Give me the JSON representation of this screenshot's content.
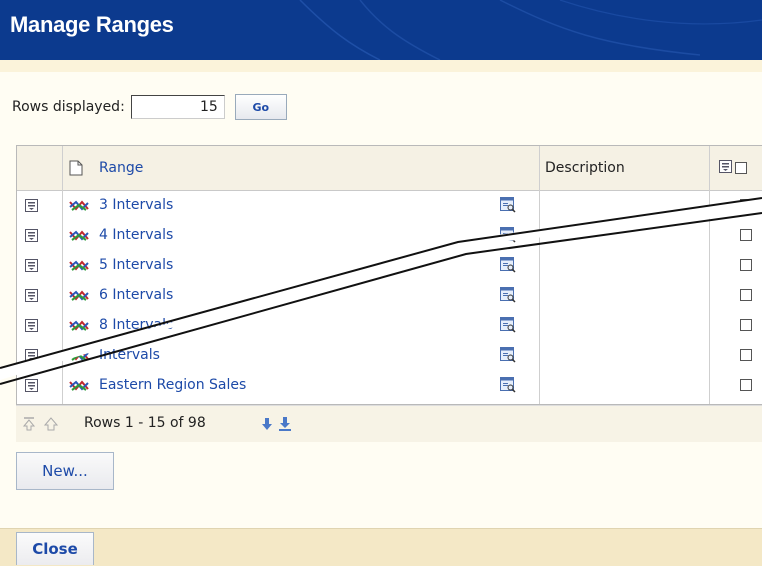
{
  "header": {
    "title": "Manage Ranges"
  },
  "controls": {
    "rows_label": "Rows displayed:",
    "rows_value": "15",
    "go_label": "Go"
  },
  "grid": {
    "columns": {
      "range": "Range",
      "description": "Description"
    },
    "rows": [
      {
        "name": "3 Intervals",
        "description": "",
        "checked": false
      },
      {
        "name": "4 Intervals",
        "description": "",
        "checked": false
      },
      {
        "name": "5 Intervals",
        "description": "",
        "checked": false
      },
      {
        "name": "6 Intervals",
        "description": "",
        "checked": false
      },
      {
        "name": "8 Intervals",
        "description": "",
        "checked": false
      },
      {
        "name": "Intervals",
        "description": "",
        "checked": false
      },
      {
        "name": "Eastern Region Sales",
        "description": "",
        "checked": false
      }
    ]
  },
  "pager": {
    "text": "Rows 1 - 15 of 98"
  },
  "buttons": {
    "new_label": "New...",
    "close_label": "Close"
  },
  "colors": {
    "header_bg": "#0c3a8e",
    "link": "#1d4aa8",
    "bottom_bar": "#f4e8c6"
  },
  "icons": [
    "row-menu-icon",
    "range-chart-icon",
    "details-icon",
    "document-icon",
    "first-page-icon",
    "prev-page-icon",
    "next-page-icon",
    "last-page-icon"
  ]
}
